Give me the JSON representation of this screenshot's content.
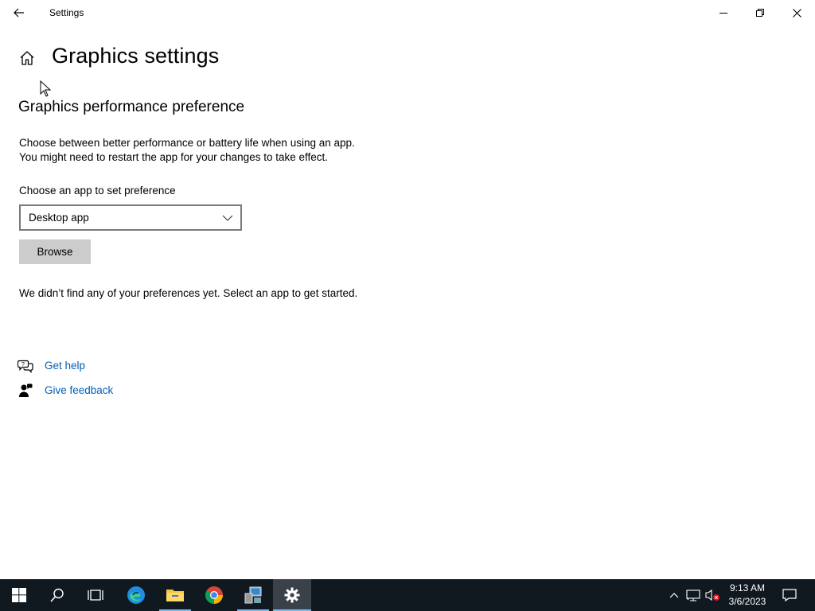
{
  "window": {
    "title": "Settings"
  },
  "header": {
    "page_title": "Graphics settings"
  },
  "section": {
    "title": "Graphics performance preference",
    "description_line1": "Choose between better performance or battery life when using an app.",
    "description_line2": "You might need to restart the app for your changes to take effect.",
    "choose_label": "Choose an app to set preference",
    "dropdown_value": "Desktop app",
    "browse_label": "Browse",
    "empty_message": "We didn’t find any of your preferences yet. Select an app to get started."
  },
  "help": {
    "get_help": "Get help",
    "give_feedback": "Give feedback"
  },
  "taskbar": {
    "time": "9:13 AM",
    "date": "3/6/2023",
    "items": [
      "start-icon",
      "search-icon",
      "task-view-icon",
      "edge-icon",
      "file-explorer-icon",
      "chrome-icon",
      "control-panel-icon",
      "settings-icon"
    ]
  },
  "colors": {
    "link": "#005fb8",
    "taskbar_bg": "#101820",
    "button_bg": "#cccccc",
    "active_indicator": "#76b9ed"
  }
}
